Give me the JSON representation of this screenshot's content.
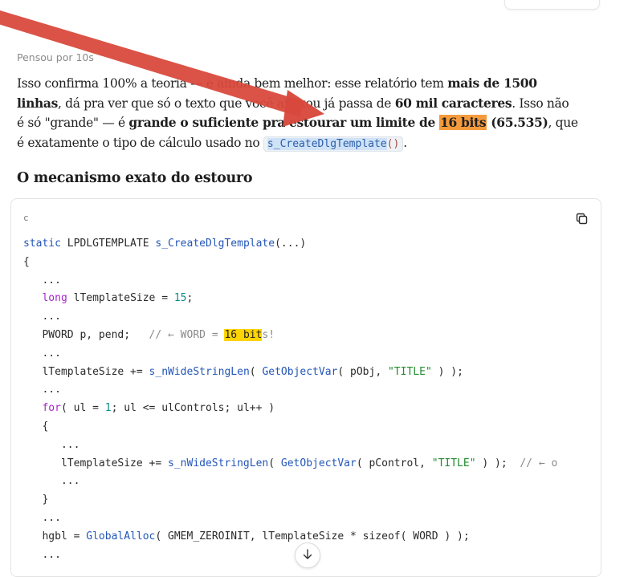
{
  "thought_label": "Pensou por 10s",
  "paragraph": {
    "p1": "Isso confirma 100% a teoria — e ainda bem melhor: esse relatório tem ",
    "b1": "mais de 1500 linhas",
    "p2": ", dá pra ver que só o texto que você anexou já passa de ",
    "b2": "60 mil caracteres",
    "p3": ". Isso não é só \"grande\" — é ",
    "b3": "grande o suficiente pra estourar um limite de ",
    "b3_hl": "16 bits",
    "b3_tail": " (65.535)",
    "p4": ", que é exatamente o tipo de cálculo usado no ",
    "code_fn": "s_CreateDlgTemplate",
    "code_paren": "()",
    "p5": "."
  },
  "heading": "O mecanismo exato do estouro",
  "code_block": {
    "language": "c",
    "copy_icon": "copy-icon"
  },
  "code": {
    "l1_kw": "static",
    "l1_type": " LPDLGTEMPLATE ",
    "l1_fn": "s_CreateDlgTemplate",
    "l1_rest": "(...)",
    "l2": "{",
    "l3": "   ...",
    "l4_kw": "long",
    "l4_mid": " lTemplateSize = ",
    "l4_num": "15",
    "l4_end": ";",
    "l5": "   ...",
    "l6_a": "   PWORD p, pend;   ",
    "l6_cm": "// ← WORD = ",
    "l6_hl": "16 bit",
    "l6_cm2": "s!",
    "l7": "   ...",
    "l8_a": "   lTemplateSize += ",
    "l8_fn1": "s_nWideStringLen",
    "l8_b": "( ",
    "l8_fn2": "GetObjectVar",
    "l8_c": "( pObj, ",
    "l8_str": "\"TITLE\"",
    "l8_d": " ) );",
    "l9": "   ...",
    "l10_kw": "for",
    "l10_a": "( ul = ",
    "l10_num": "1",
    "l10_b": "; ul <= ulControls; ul++ )",
    "l11": "   {",
    "l12": "      ...",
    "l13_a": "      lTemplateSize += ",
    "l13_fn1": "s_nWideStringLen",
    "l13_b": "( ",
    "l13_fn2": "GetObjectVar",
    "l13_c": "( pControl, ",
    "l13_str": "\"TITLE\"",
    "l13_d": " ) );  ",
    "l13_cm": "// ← o",
    "l14": "      ...",
    "l15": "   }",
    "l16": "   ...",
    "l17_a": "   hgbl = ",
    "l17_fn": "GlobalAlloc",
    "l17_b": "( GMEM_ZEROINIT, lTemplateSize * sizeof( WORD ) );",
    "l18": "   ..."
  },
  "colors": {
    "annotation_arrow": "#d9483b",
    "highlight_orange": "#f59b3d",
    "highlight_yellow": "#ffd400"
  }
}
